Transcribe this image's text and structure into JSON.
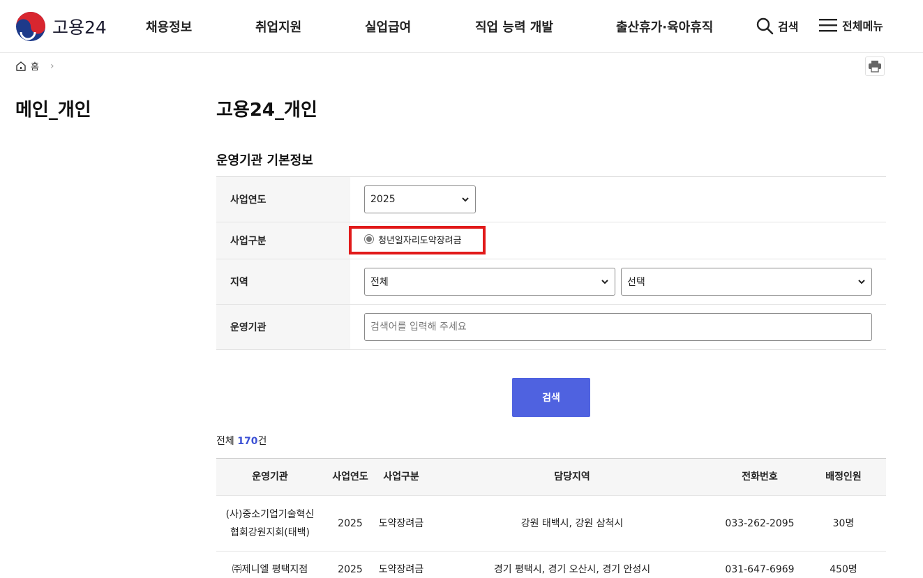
{
  "header": {
    "logo_text": "고용24",
    "nav": [
      "채용정보",
      "취업지원",
      "실업급여",
      "직업 능력 개발",
      "출산휴가·육아휴직"
    ],
    "search_label": "검색",
    "menu_label": "전체메뉴"
  },
  "breadcrumb": {
    "home": "홈"
  },
  "sidebar": {
    "title": "메인_개인"
  },
  "main": {
    "title": "고용24_개인",
    "section_title": "운영기관 기본정보"
  },
  "form": {
    "year_label": "사업연도",
    "year_value": "2025",
    "type_label": "사업구분",
    "type_value": "청년일자리도약장려금",
    "region_label": "지역",
    "region_value": "전체",
    "region_sub_value": "선택",
    "org_label": "운영기관",
    "org_placeholder": "검색어를 입력해 주세요",
    "search_button": "검색"
  },
  "results": {
    "total_prefix": "전체 ",
    "total_count": "170",
    "total_suffix": "건",
    "columns": [
      "운영기관",
      "사업연도",
      "사업구분",
      "담당지역",
      "전화번호",
      "배정인원"
    ],
    "rows": [
      {
        "org_line1": "(사)중소기업기술혁신",
        "org_line2": "협회강원지회(태백)",
        "year": "2025",
        "type": "도약장려금",
        "region": "강원 태백시, 강원 삼척시",
        "phone": "033-262-2095",
        "count": "30명"
      },
      {
        "org_line1": "㈜제니엘 평택지점",
        "org_line2": "",
        "year": "2025",
        "type": "도약장려금",
        "region": "경기 평택시, 경기 오산시, 경기 안성시",
        "phone": "031-647-6969",
        "count": "450명"
      }
    ]
  },
  "colors": {
    "accent": "#4f62e0",
    "highlight": "#e11a1a",
    "count": "#3d52d5"
  }
}
